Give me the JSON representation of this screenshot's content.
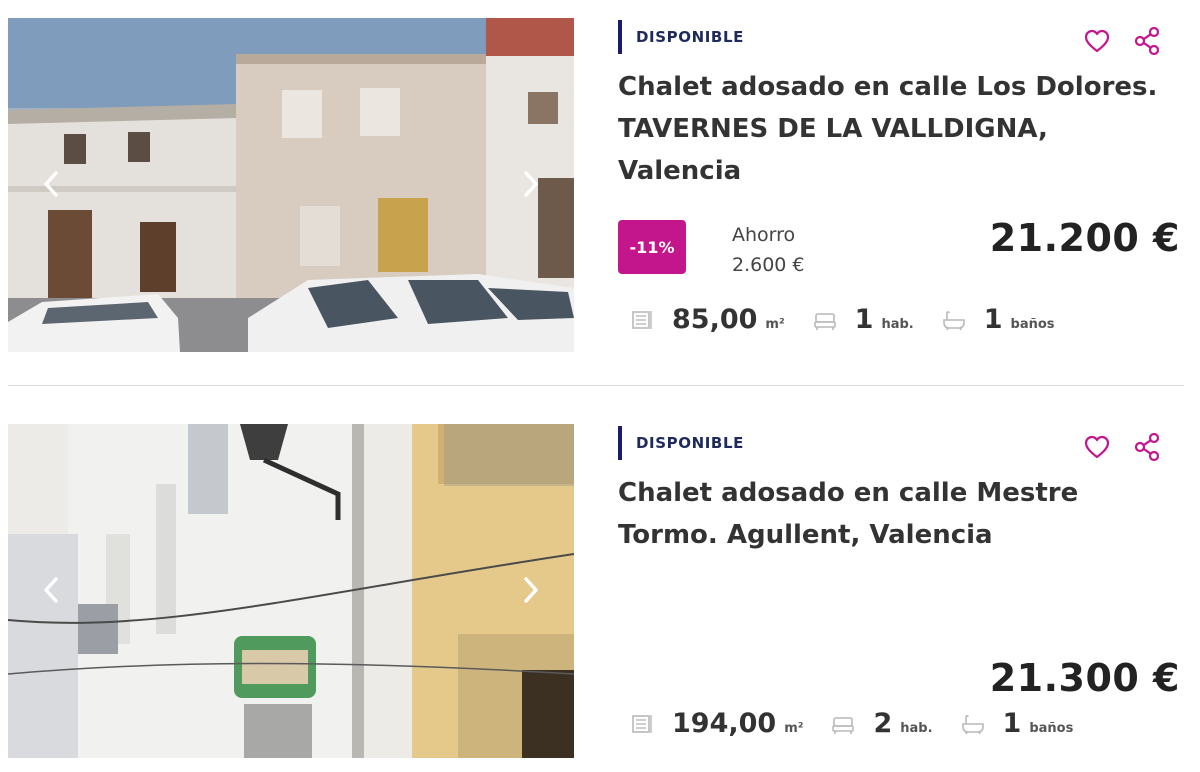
{
  "listings": [
    {
      "status": "DISPONIBLE",
      "title": "Chalet adosado en calle Los Dolores. TAVERNES DE LA VALLDIGNA, Valencia",
      "discount": "-11%",
      "saving_label": "Ahorro",
      "saving_value": "2.600 €",
      "price": "21.200 €",
      "area": "85,00",
      "area_unit": "m²",
      "rooms": "1",
      "rooms_unit": "hab.",
      "baths": "1",
      "baths_unit": "baños"
    },
    {
      "status": "DISPONIBLE",
      "title": "Chalet adosado en calle Mestre Tormo. Agullent, Valencia",
      "price": "21.300 €",
      "area": "194,00",
      "area_unit": "m²",
      "rooms": "2",
      "rooms_unit": "hab.",
      "baths": "1",
      "baths_unit": "baños"
    }
  ],
  "colors": {
    "accent": "#c4168c",
    "status_bar": "#1a1a6e",
    "text": "#333333",
    "divider": "#d9d9e0"
  },
  "icons": [
    "chevron-left-icon",
    "chevron-right-icon",
    "heart-icon",
    "share-icon",
    "area-icon",
    "bed-icon",
    "bath-icon"
  ]
}
